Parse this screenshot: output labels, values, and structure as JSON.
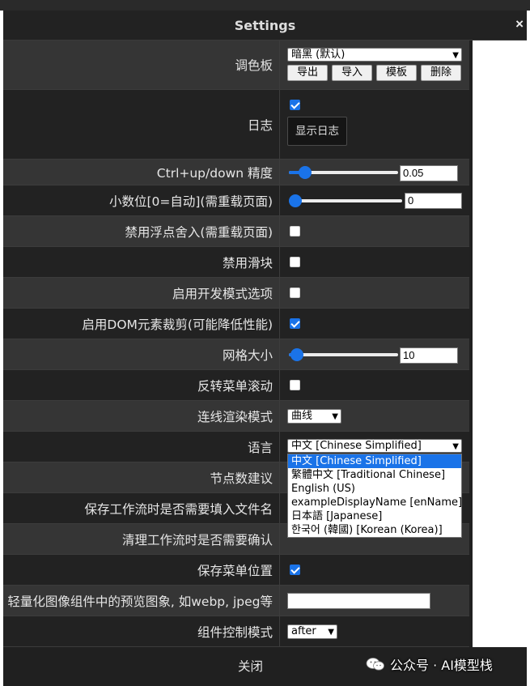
{
  "dialog": {
    "title": "Settings",
    "close_symbol": "×",
    "close_label": "关闭"
  },
  "rows": {
    "palette": {
      "label": "调色板",
      "selected": "暗黑 (默认)",
      "buttons": [
        "导出",
        "导入",
        "模板",
        "删除"
      ]
    },
    "log": {
      "label": "日志",
      "checked": true,
      "button": "显示日志"
    },
    "ctrl_precision": {
      "label": "Ctrl+up/down 精度",
      "value": "0.05",
      "slider_fraction": 0.1
    },
    "decimals": {
      "label": "小数位[0=自动](需重载页面)",
      "value": "0",
      "slider_fraction": 0.0
    },
    "disable_float_round": {
      "label": "禁用浮点舍入(需重载页面)",
      "checked": false
    },
    "disable_sliders": {
      "label": "禁用滑块",
      "checked": false
    },
    "dev_mode": {
      "label": "启用开发模式选项",
      "checked": false
    },
    "dom_clipping": {
      "label": "启用DOM元素裁剪(可能降低性能)",
      "checked": true
    },
    "grid_size": {
      "label": "网格大小",
      "value": "10",
      "slider_fraction": 0.02
    },
    "invert_menu_scroll": {
      "label": "反转菜单滚动",
      "checked": false
    },
    "link_render": {
      "label": "连线渲染模式",
      "selected": "曲线"
    },
    "language": {
      "label": "语言",
      "selected": "中文 [Chinese Simplified]"
    },
    "node_suggestions": {
      "label": "节点数建议"
    },
    "prompt_filename": {
      "label": "保存工作流时是否需要填入文件名"
    },
    "confirm_clear": {
      "label": "清理工作流时是否需要确认"
    },
    "save_menu_position": {
      "label": "保存菜单位置",
      "checked": true
    },
    "preview_format": {
      "label": "轻量化图像组件中的预览图象, 如webp, jpeg等",
      "value": ""
    },
    "widget_control": {
      "label": "组件控制模式",
      "selected": "after"
    }
  },
  "language_options": [
    "中文 [Chinese Simplified]",
    "繁體中文 [Traditional Chinese]",
    "English (US)",
    "exampleDisplayName [enName]",
    "日本語 [Japanese]",
    "한국어 (韓國) [Korean (Korea)]"
  ],
  "watermark": "公众号 · AI模型栈",
  "colors": {
    "accent": "#1a73e8",
    "row_dark": "#222222",
    "row_light": "#353535"
  }
}
